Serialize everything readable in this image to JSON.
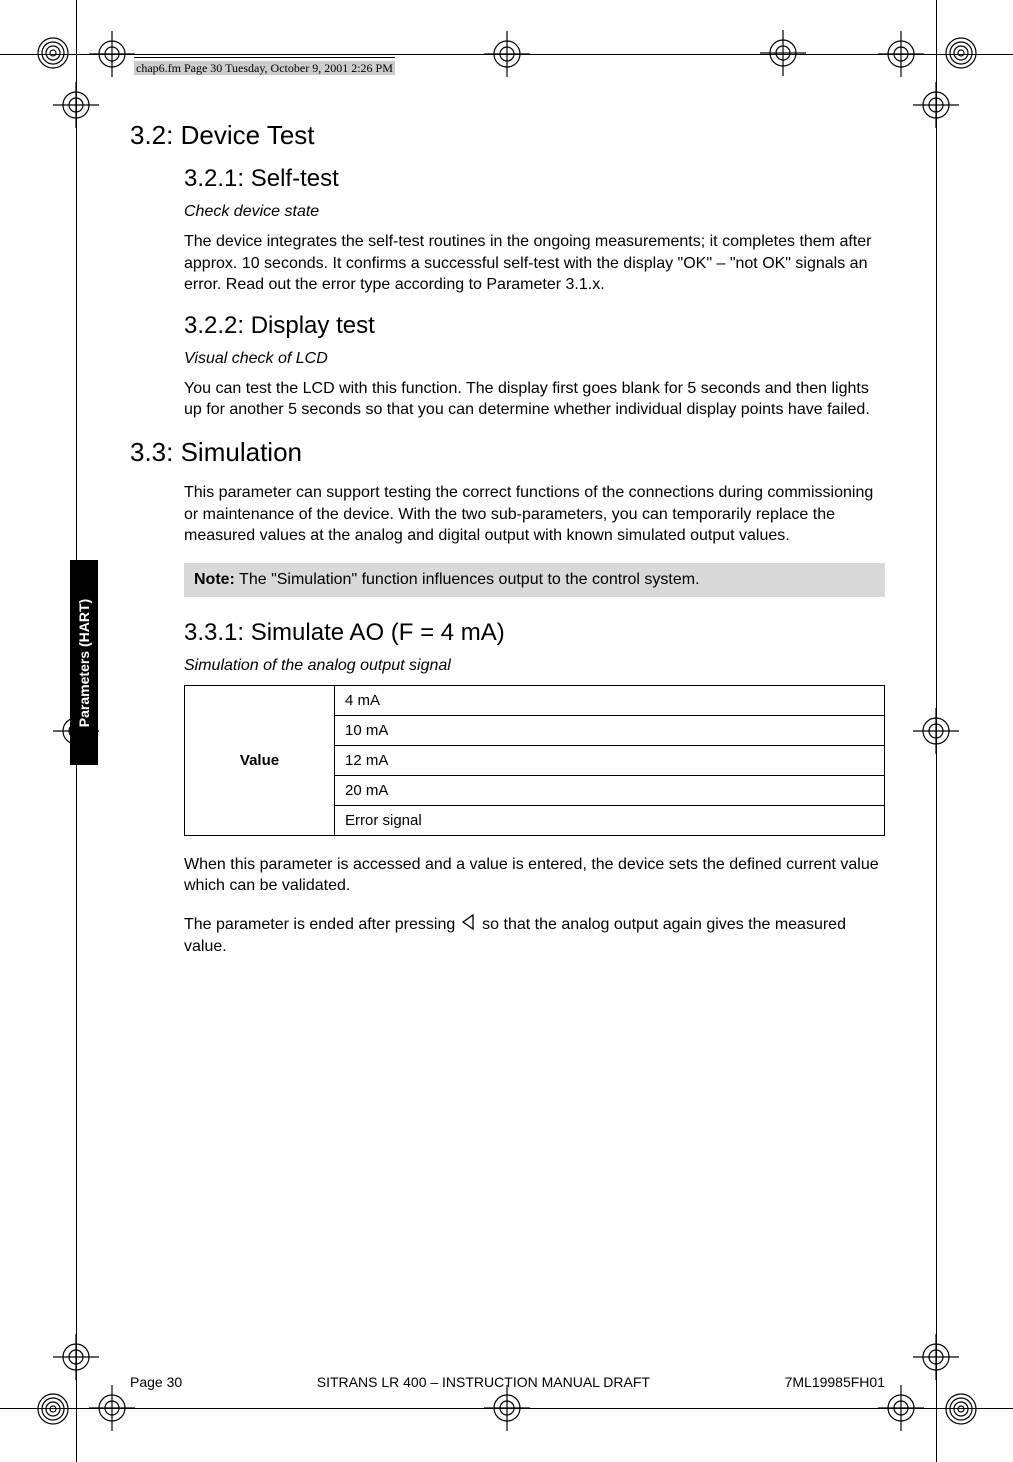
{
  "header": {
    "path": "chap6.fm  Page 30  Tuesday, October 9, 2001  2:26 PM"
  },
  "sidetab": {
    "label": "Parameters (HART)"
  },
  "sec32": {
    "heading": "3.2: Device Test"
  },
  "sec321": {
    "heading": "3.2.1: Self-test",
    "subtitle": "Check device state",
    "body": "The device integrates the self-test routines in the ongoing measurements; it completes them after approx. 10 seconds. It confirms a successful self-test with the display \"OK\" – \"not OK\" signals an error. Read out the error type according to Parameter 3.1.x."
  },
  "sec322": {
    "heading": "3.2.2: Display test",
    "subtitle": "Visual check of LCD",
    "body": "You can test the LCD with this function. The display first goes blank for 5 seconds and then lights up for another 5 seconds so that you can determine whether individual display points have failed."
  },
  "sec33": {
    "heading": "3.3: Simulation",
    "body": "This parameter can support testing the correct functions of the connections during commissioning or maintenance of the device. With the two sub-parameters, you can temporarily replace the measured values at the analog and digital output with known simulated output values.",
    "note_label": "Note:",
    "note_body": " The \"Simulation\" function influences output to the control system."
  },
  "sec331": {
    "heading": "3.3.1: Simulate AO (F = 4 mA)",
    "subtitle": "Simulation of the analog output signal",
    "rowhead": "Value",
    "rows": [
      "4 mA",
      "10 mA",
      "12 mA",
      "20 mA",
      "Error signal"
    ],
    "body1": "When this parameter is accessed and a value is entered, the device sets the defined current value which can be validated.",
    "body2a": "The parameter is ended after pressing ",
    "body2b": " so that the analog output again gives the measured value."
  },
  "footer": {
    "page": "Page 30",
    "title": "SITRANS LR 400 – INSTRUCTION MANUAL DRAFT",
    "docnum": "7ML19985FH01"
  },
  "chart_data": {
    "type": "table",
    "title": "Simulate AO values",
    "columns": [
      "Value"
    ],
    "rows": [
      [
        "4 mA"
      ],
      [
        "10 mA"
      ],
      [
        "12 mA"
      ],
      [
        "20 mA"
      ],
      [
        "Error signal"
      ]
    ]
  }
}
